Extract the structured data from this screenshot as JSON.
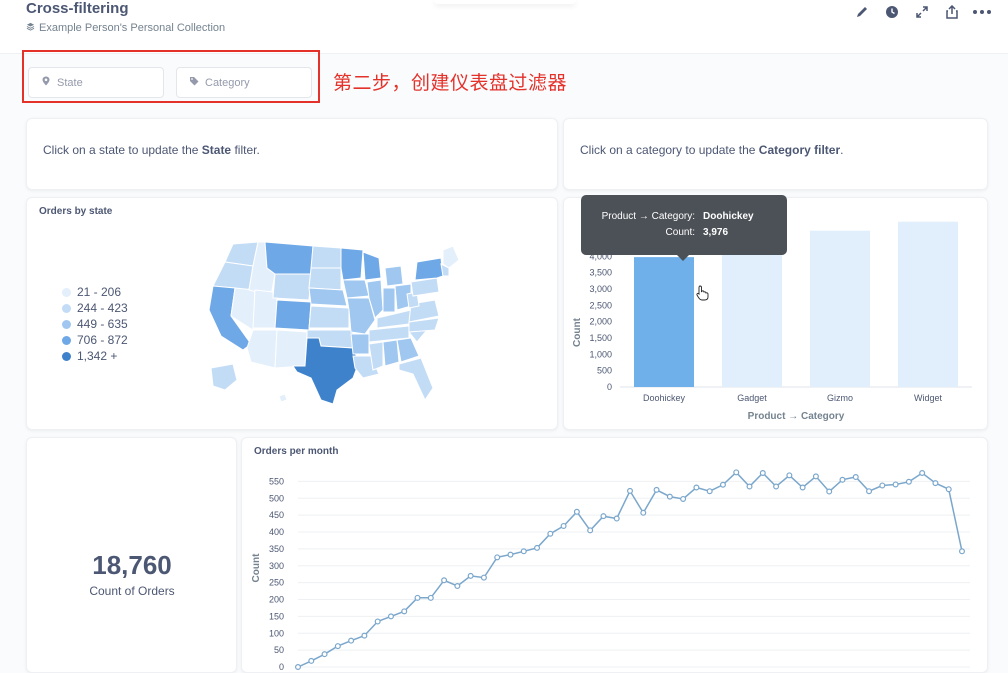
{
  "header": {
    "title": "Cross-filtering",
    "collection": "Example Person's Personal Collection"
  },
  "filters": {
    "state_label": "State",
    "category_label": "Category"
  },
  "annotation": "第二步，创建仪表盘过滤器",
  "cards": {
    "state_text_prefix": "Click on a state to update the ",
    "state_text_bold": "State",
    "state_text_suffix": " filter.",
    "category_text_prefix": "Click on a category to update the ",
    "category_text_bold": "Category filter",
    "category_text_suffix": "."
  },
  "map": {
    "title": "Orders by state",
    "legend": [
      {
        "label": "21 - 206",
        "color": "#e3effb"
      },
      {
        "label": "244 - 423",
        "color": "#c3dcf6"
      },
      {
        "label": "449 - 635",
        "color": "#9fc7f0"
      },
      {
        "label": "706 - 872",
        "color": "#6ea8e6"
      },
      {
        "label": "1,342 +",
        "color": "#3f82cc"
      }
    ]
  },
  "kpi": {
    "value": "18,760",
    "label": "Count of Orders"
  },
  "tooltip": {
    "row1_key": "Product → Category:",
    "row1_value": "Doohickey",
    "row2_key": "Count:",
    "row2_value": "3,976"
  },
  "chart_data": [
    {
      "type": "bar",
      "title": "",
      "xlabel": "Product → Category",
      "ylabel": "Count",
      "categories": [
        "Doohickey",
        "Gadget",
        "Gizmo",
        "Widget"
      ],
      "values": [
        3976,
        4939,
        4784,
        5061
      ],
      "ylim": [
        0,
        4500
      ],
      "yticks": [
        0,
        500,
        1000,
        1500,
        2000,
        2500,
        3000,
        3500,
        4000
      ],
      "highlight_index": 0,
      "colors": {
        "active": "#6fb0ea",
        "inactive": "#e1eefb"
      },
      "grid": false
    },
    {
      "type": "line",
      "title": "Orders per month",
      "ylabel": "Count",
      "ylim": [
        0,
        575
      ],
      "yticks": [
        0,
        50,
        100,
        150,
        200,
        250,
        300,
        350,
        400,
        450,
        500,
        550
      ],
      "color": "#7ba7cc",
      "values": [
        0,
        18,
        38,
        62,
        78,
        93,
        135,
        150,
        165,
        205,
        205,
        257,
        240,
        270,
        265,
        325,
        333,
        343,
        353,
        395,
        418,
        460,
        405,
        447,
        440,
        522,
        457,
        525,
        505,
        498,
        532,
        521,
        540,
        577,
        535,
        575,
        535,
        568,
        532,
        565,
        520,
        555,
        563,
        521,
        538,
        541,
        549,
        575,
        545,
        527,
        343
      ],
      "grid": true
    }
  ]
}
